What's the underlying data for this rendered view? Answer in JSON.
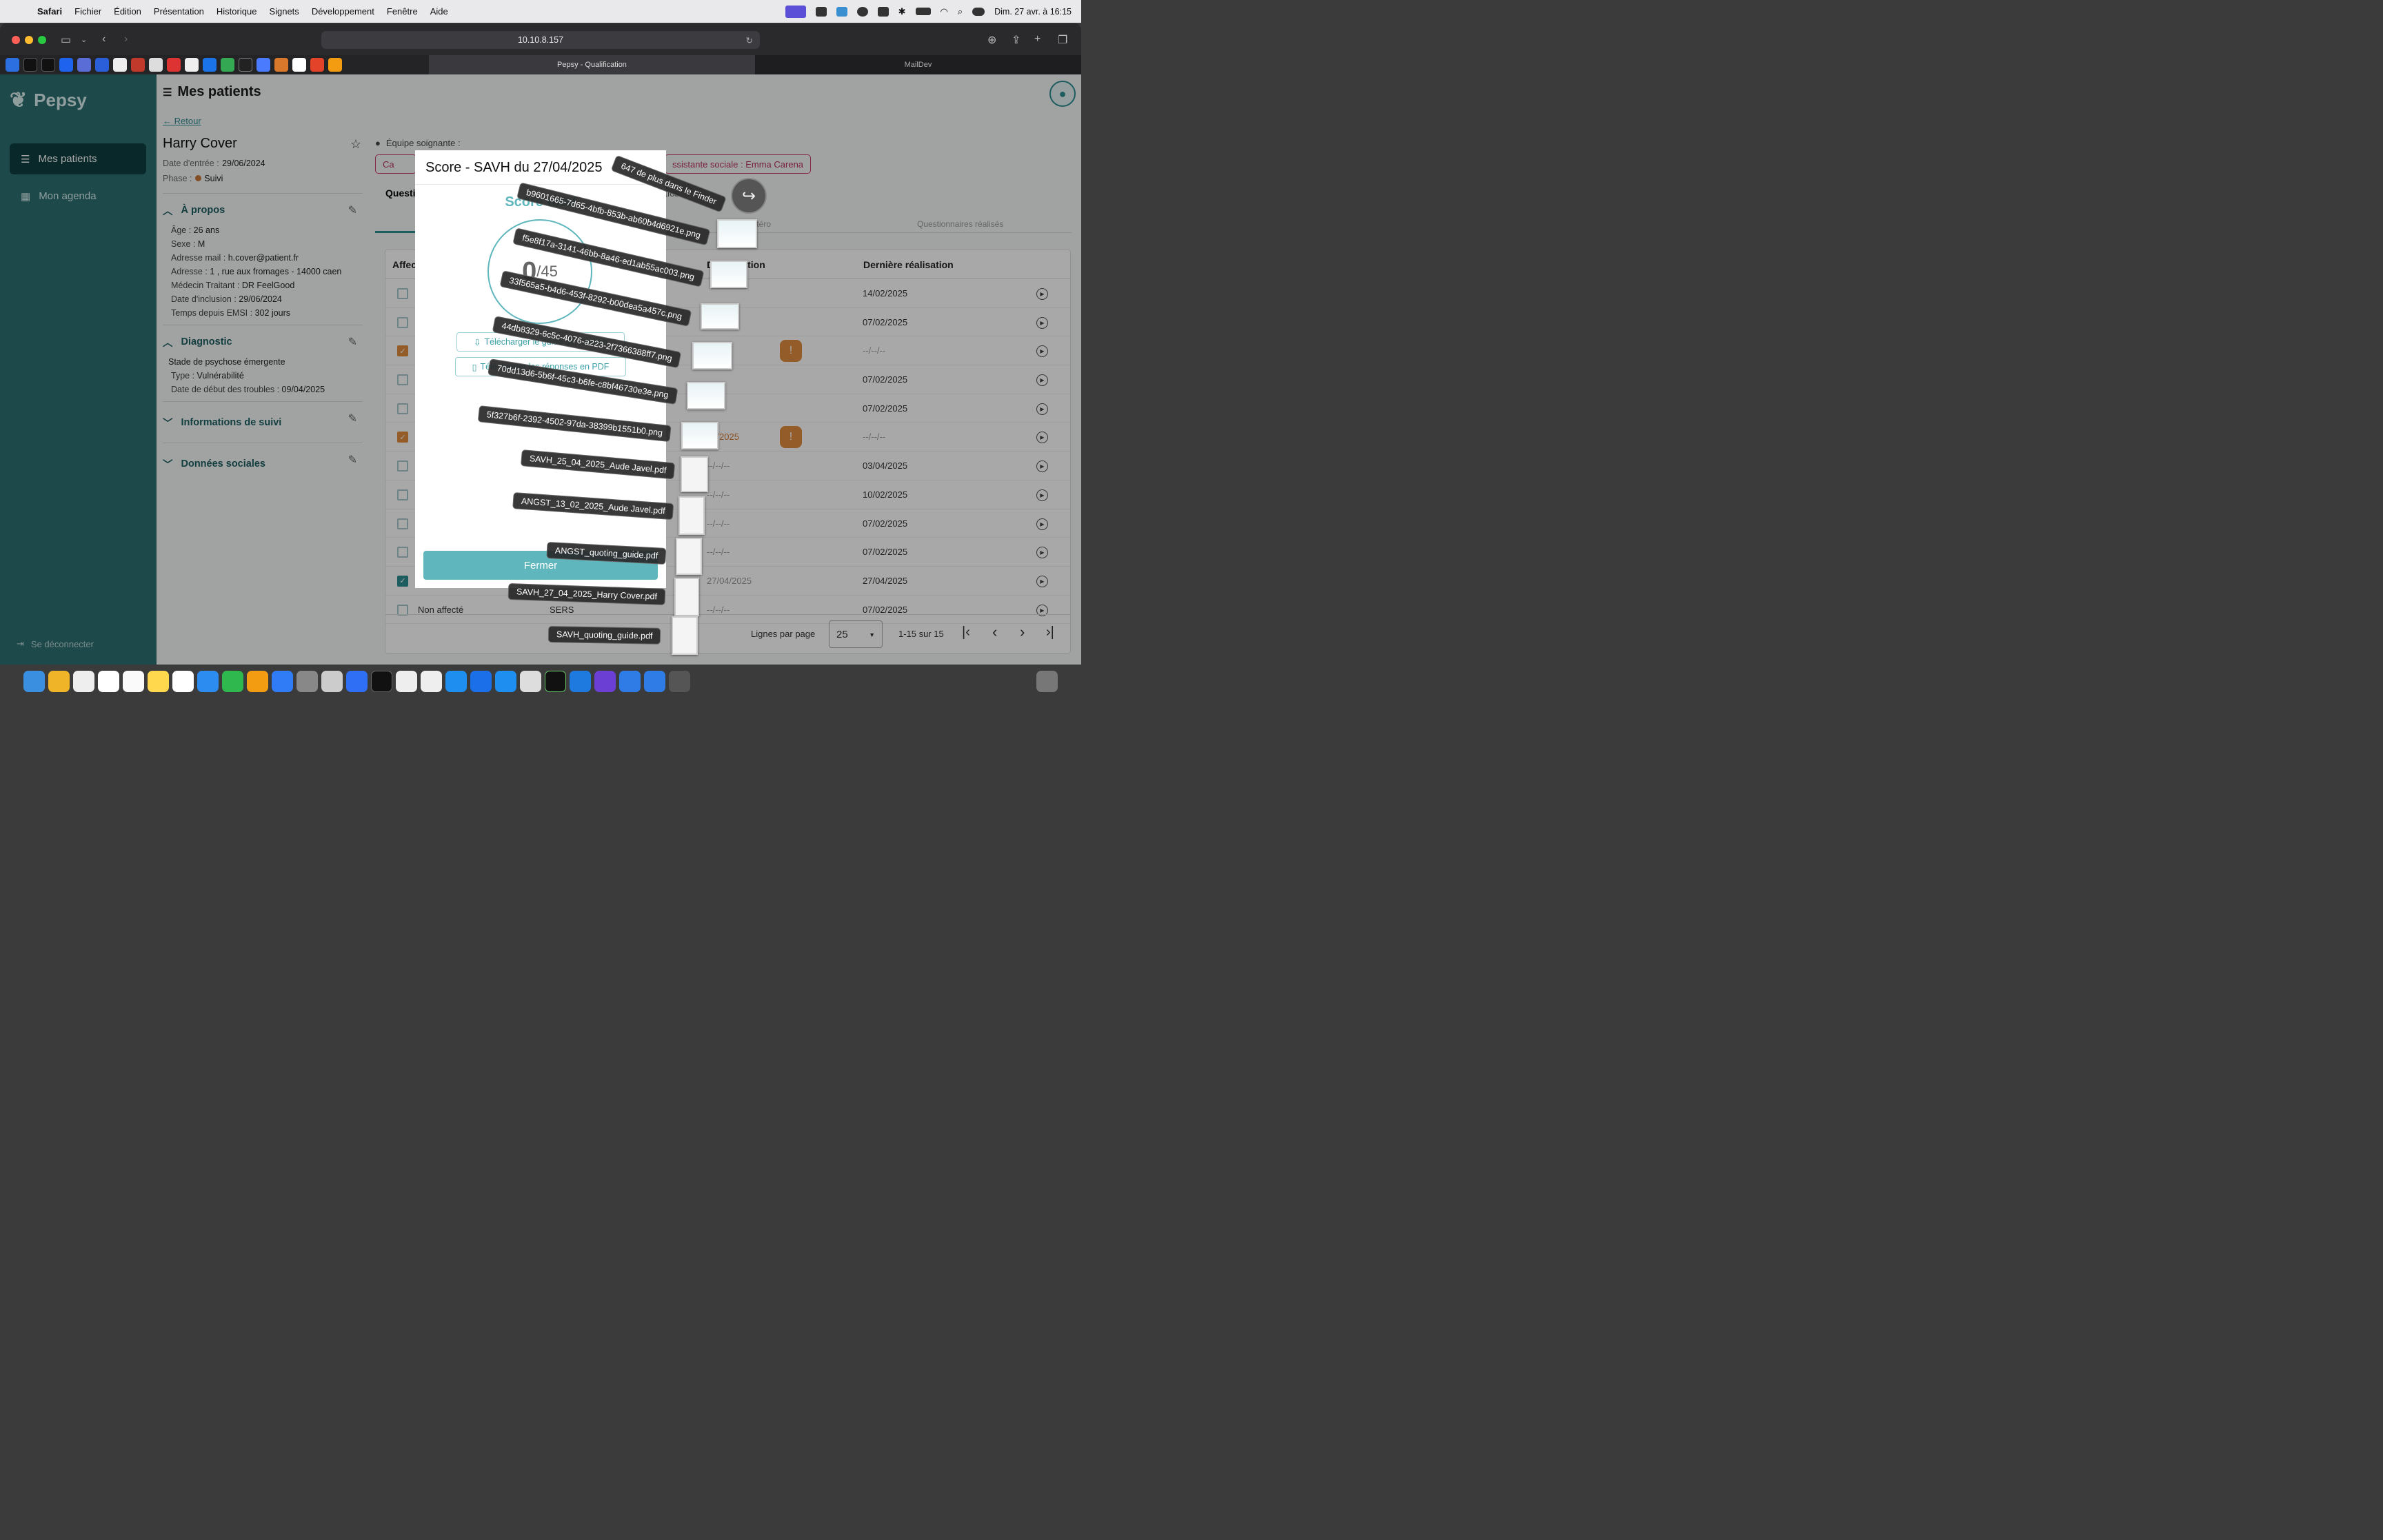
{
  "menubar": {
    "app": "Safari",
    "items": [
      "Fichier",
      "Édition",
      "Présentation",
      "Historique",
      "Signets",
      "Développement",
      "Fenêtre",
      "Aide"
    ],
    "datetime": "Dim. 27 avr. à 16:15"
  },
  "browser": {
    "url": "10.10.8.157",
    "tabs": [
      {
        "label": "Pepsy - Qualification",
        "active": true
      },
      {
        "label": "MailDev",
        "active": false
      }
    ]
  },
  "app": {
    "logo": "Pepsy",
    "nav": [
      {
        "label": "Mes patients",
        "icon": "patients-icon",
        "active": true
      },
      {
        "label": "Mon agenda",
        "icon": "calendar-icon",
        "active": false
      }
    ],
    "logout": "Se déconnecter",
    "page_title": "Mes patients"
  },
  "patient": {
    "back": "Retour",
    "name": "Harry Cover",
    "entry_label": "Date d'entrée :",
    "entry_date": "29/06/2024",
    "phase_label": "Phase :",
    "phase": "Suivi",
    "apropos": {
      "title": "À propos",
      "rows": [
        {
          "k": "Âge :",
          "v": "26 ans"
        },
        {
          "k": "Sexe :",
          "v": "M"
        },
        {
          "k": "Adresse mail :",
          "v": "h.cover@patient.fr"
        },
        {
          "k": "Adresse :",
          "v": "1 , rue aux fromages - 14000 caen"
        },
        {
          "k": "Médecin Traitant :",
          "v": "DR FeelGood"
        },
        {
          "k": "Date d'inclusion :",
          "v": "29/06/2024"
        },
        {
          "k": "Temps depuis EMSI :",
          "v": "302 jours"
        }
      ]
    },
    "diagnostic": {
      "title": "Diagnostic",
      "stage": "Stade de psychose émergente",
      "rows": [
        {
          "k": "Type :",
          "v": "Vulnérabilité"
        },
        {
          "k": "Date de début des troubles :",
          "v": "09/04/2025"
        }
      ]
    },
    "suivi_title": "Informations de suivi",
    "sociales_title": "Données sociales"
  },
  "team": {
    "label": "Équipe soignante :",
    "chip1": "Ca",
    "chip2": "ssistante sociale : Emma Carena"
  },
  "tabs": {
    "questionnaires": "Questi",
    "tics": "tics",
    "hetero": "hétéro",
    "realises": "Questionnaires réalisés"
  },
  "table": {
    "headers": {
      "affec": "Affec",
      "date_aff": "D",
      "affectation": "affectation",
      "derniere": "Dernière réalisation"
    },
    "rows": [
      {
        "checked": "none",
        "aff": "",
        "last": "14/02/2025"
      },
      {
        "checked": "none",
        "aff": "",
        "last": "07/02/2025"
      },
      {
        "checked": "orange",
        "aff": "2025",
        "last": "--/--/--",
        "alert": true
      },
      {
        "checked": "none",
        "aff": "",
        "last": "07/02/2025"
      },
      {
        "checked": "none",
        "aff": "",
        "last": "07/02/2025"
      },
      {
        "checked": "orange",
        "aff": "02/2025",
        "last": "--/--/--",
        "alert": true
      },
      {
        "checked": "none",
        "aff": "--/--/--",
        "last": "03/04/2025"
      },
      {
        "checked": "none",
        "aff": "--/--/--",
        "last": "10/02/2025"
      },
      {
        "checked": "none",
        "aff": "--/--/--",
        "last": "07/02/2025"
      },
      {
        "checked": "none",
        "aff": "--/--/--",
        "last": "07/02/2025"
      },
      {
        "checked": "teal",
        "aff": "27/04/2025",
        "last": "27/04/2025"
      },
      {
        "checked": "none",
        "label": "Non affecté",
        "type": "SERS",
        "aff": "--/--/--",
        "last": "07/02/2025"
      }
    ],
    "footer": {
      "rows_label": "Lignes par page",
      "rows_value": "25",
      "range": "1-15 sur 15"
    }
  },
  "modal": {
    "title": "Score - SAVH du 27/04/2025",
    "score_title": "Score total",
    "score_value": "0",
    "score_max": "/45",
    "btn_guide": "Télécharger le guide de cotation",
    "btn_pdf": "Télécharger les réponses en PDF",
    "close": "Fermer"
  },
  "drag": {
    "more": "647 de plus dans le Finder",
    "files": [
      "b9601665-7d65-4bfb-853b-ab60b4d6921e.png",
      "f5e8f17a-3141-46bb-8a46-ed1ab55ac003.png",
      "33f565a5-b4d6-453f-8292-b00dea5a457c.png",
      "44db8329-6c5c-4076-a223-2f7366388ff7.png",
      "70dd13d6-5b6f-45c3-b6fe-c8bf46730e3e.png",
      "5f327b6f-2392-4502-97da-38399b1551b0.png",
      "SAVH_25_04_2025_Aude Javel.pdf",
      "ANGST_13_02_2025_Aude Javel.pdf",
      "ANGST_quoting_guide.pdf",
      "SAVH_27_04_2025_Harry Cover.pdf",
      "SAVH_quoting_guide.pdf"
    ]
  }
}
